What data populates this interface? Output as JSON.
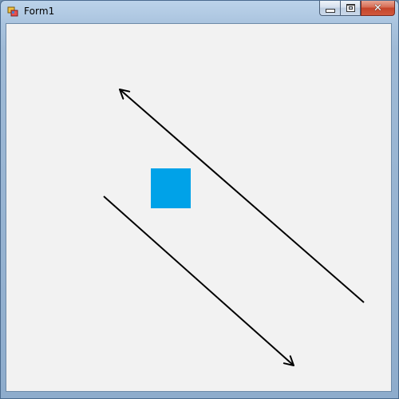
{
  "window": {
    "title": "Form1",
    "icon": "winforms-app-icon",
    "caption_buttons": {
      "minimize": "minimize-icon",
      "maximize": "restore-icon",
      "close": "close-icon"
    },
    "close_glyph": "✕"
  },
  "canvas": {
    "background": "#f2f2f2",
    "square_color": "#00a2e8",
    "line_color": "#000000"
  }
}
